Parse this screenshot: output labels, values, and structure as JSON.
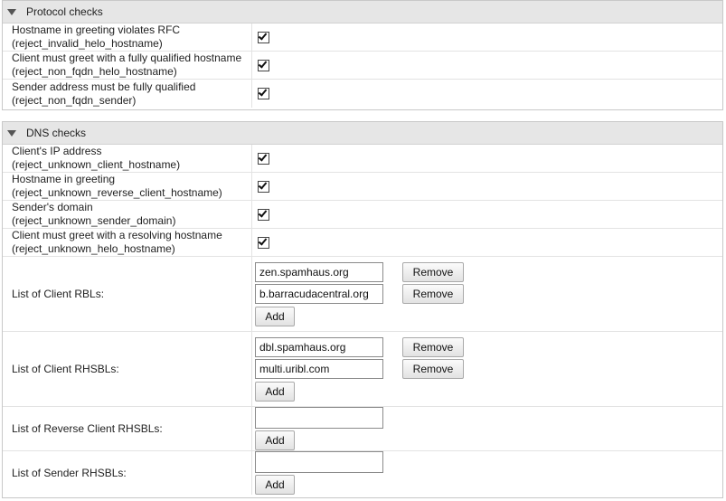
{
  "protocol_checks": {
    "title": "Protocol checks",
    "rows": [
      {
        "label": "Hostname in greeting violates RFC",
        "param": "(reject_invalid_helo_hostname)",
        "checked": true
      },
      {
        "label": "Client must greet with a fully qualified hostname",
        "param": "(reject_non_fqdn_helo_hostname)",
        "checked": true
      },
      {
        "label": "Sender address must be fully qualified",
        "param": "(reject_non_fqdn_sender)",
        "checked": true
      }
    ]
  },
  "dns_checks": {
    "title": "DNS checks",
    "rows": [
      {
        "label": "Client's IP address",
        "param": "(reject_unknown_client_hostname)",
        "checked": true
      },
      {
        "label": "Hostname in greeting",
        "param": "(reject_unknown_reverse_client_hostname)",
        "checked": true
      },
      {
        "label": "Sender's domain",
        "param": "(reject_unknown_sender_domain)",
        "checked": true
      },
      {
        "label": "Client must greet with a resolving hostname",
        "param": "(reject_unknown_helo_hostname)",
        "checked": true
      }
    ],
    "lists": {
      "client_rbls": {
        "label": "List of Client RBLs:",
        "entries": [
          "zen.spamhaus.org",
          "b.barracudacentral.org"
        ]
      },
      "client_rhsbls": {
        "label": "List of Client RHSBLs:",
        "entries": [
          "dbl.spamhaus.org",
          "multi.uribl.com"
        ]
      },
      "reverse_client_rhsbls": {
        "label": "List of Reverse Client RHSBLs:",
        "entries": [
          ""
        ]
      },
      "sender_rhsbls": {
        "label": "List of Sender RHSBLs:",
        "entries": [
          ""
        ]
      }
    }
  },
  "buttons": {
    "remove": "Remove",
    "add": "Add"
  },
  "icons": {
    "section_toggle": "triangle-down-icon",
    "checkbox": "checkmark-icon"
  }
}
